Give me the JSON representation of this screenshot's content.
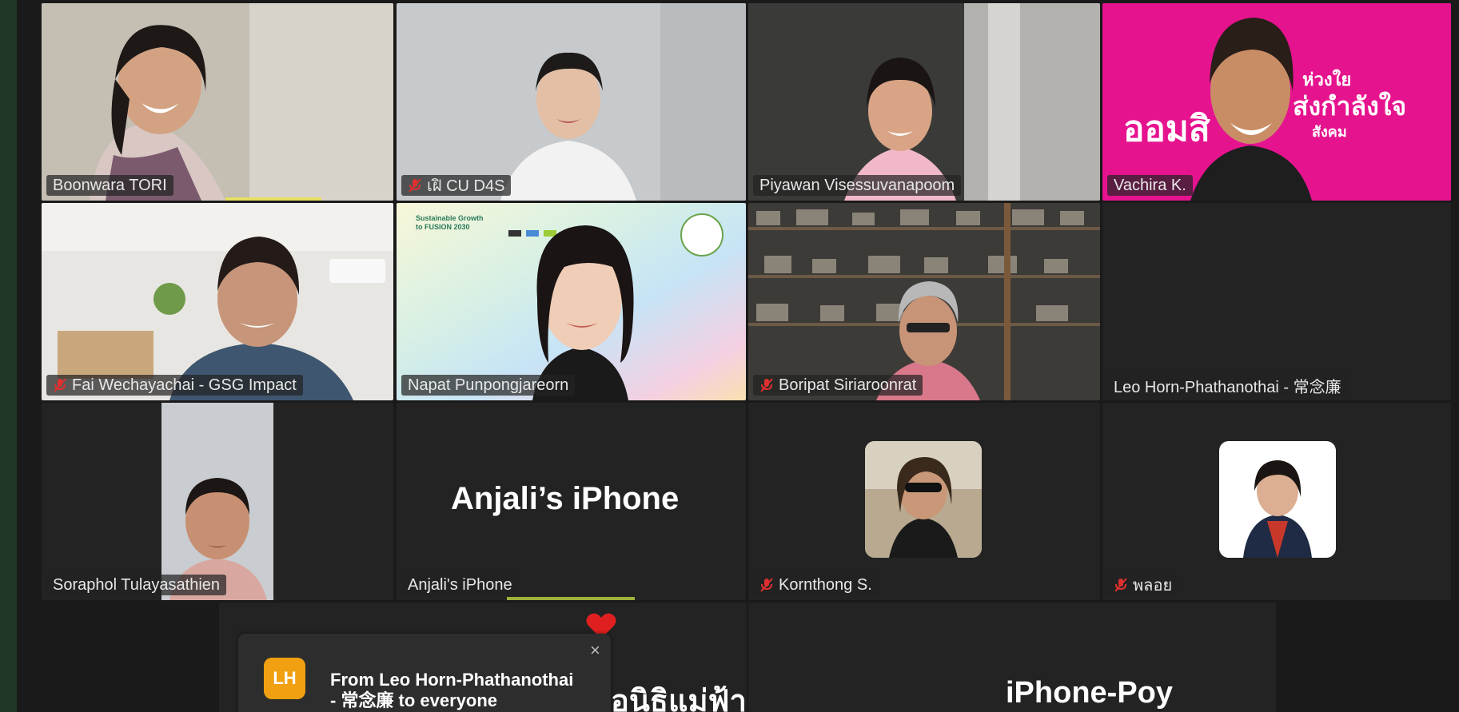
{
  "participants": [
    {
      "name": "Boonwara TORI",
      "muted": false
    },
    {
      "name": "เฝิ CU D4S",
      "muted": true
    },
    {
      "name": "Piyawan Visessuvanapoom",
      "muted": false,
      "active_speaker": true
    },
    {
      "name": "Vachira K.",
      "muted": false
    },
    {
      "name": "Fai Wechayachai - GSG Impact",
      "muted": true
    },
    {
      "name": "Napat Punpongjareorn",
      "muted": false
    },
    {
      "name": "Boripat Siriaroonrat",
      "muted": true
    },
    {
      "name": "Leo Horn-Phathanothai - 常念廉",
      "muted": false
    },
    {
      "name": "Soraphol Tulayasathien",
      "muted": false
    },
    {
      "name": "Anjali's iPhone",
      "muted": false,
      "display_label": "Anjali’s iPhone"
    },
    {
      "name": "Kornthong S.",
      "muted": true
    },
    {
      "name": "พลอย",
      "muted": true
    }
  ],
  "bottom_row": {
    "foundation_label": "อนิธิแม่ฟ้าหลวงฯ...",
    "iphone_poy_label": "iPhone-Poy"
  },
  "vachira_background_text": {
    "line1": "ห่วงใย",
    "line2": "ส่งกำลังใจ",
    "line3": "สังคม",
    "big": "ออมสิ"
  },
  "napat_background_text": {
    "title": "Sustainable Growth to FUSION 2030"
  },
  "chat_notification": {
    "initials": "LH",
    "line1": "From Leo Horn-Phathanothai",
    "line2": "- 常念廉 to everyone",
    "close_icon": "×"
  },
  "colors": {
    "active_speaker_border": "#23d18b",
    "vachira_background": "#e6138f",
    "chat_avatar": "#f0a010",
    "reaction_heart": "#e02020"
  }
}
